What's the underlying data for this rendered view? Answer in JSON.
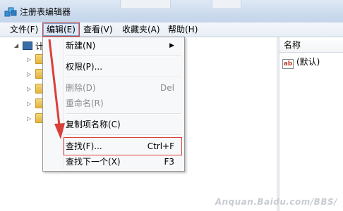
{
  "window": {
    "title": "注册表编辑器",
    "icon": "regedit-icon"
  },
  "menubar": {
    "items": [
      {
        "label": "文件(F)"
      },
      {
        "label": "编辑(E)"
      },
      {
        "label": "查看(V)"
      },
      {
        "label": "收藏夹(A)"
      },
      {
        "label": "帮助(H)"
      }
    ]
  },
  "tree": {
    "root_label": "计"
  },
  "edit_menu": {
    "new_label": "新建(N)",
    "permissions_label": "权限(P)...",
    "delete_label": "删除(D)",
    "delete_shortcut": "Del",
    "rename_label": "重命名(R)",
    "copy_key_name_label": "复制项名称(C)",
    "find_label": "查找(F)...",
    "find_shortcut": "Ctrl+F",
    "find_next_label": "查找下一个(X)",
    "find_next_shortcut": "F3"
  },
  "values_pane": {
    "column_name": "名称",
    "default_value_label": "(默认)"
  },
  "annotation": {
    "color": "#d9403a"
  },
  "watermark": "Anquan.Baidu.com/BBS/"
}
